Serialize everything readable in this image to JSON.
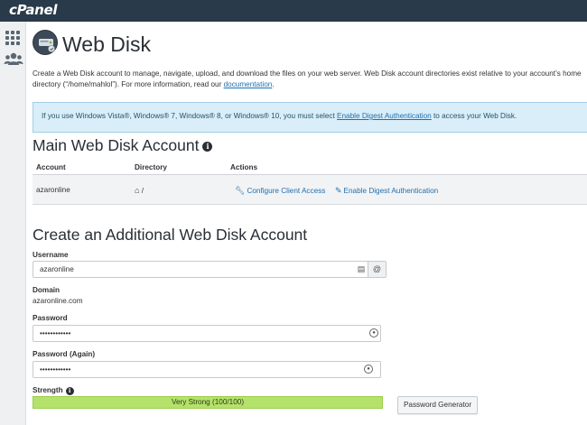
{
  "topbar": {
    "logo": "cPanel"
  },
  "rail": {
    "items": [
      {
        "icon": "grid-icon"
      },
      {
        "icon": "users-icon"
      }
    ]
  },
  "page": {
    "title": "Web Disk",
    "intro_text": "Create a Web Disk account to manage, navigate, upload, and download the files on your web server. Web Disk account directories exist relative to your account’s home directory (“/home/mahlol”). For more information, read our ",
    "intro_link": "documentation",
    "intro_end": "."
  },
  "alert": {
    "text_before": "If you use Windows Vista®, Windows® 7, Windows® 8, or Windows® 10, you must select ",
    "link": "Enable Digest Authentication",
    "text_after": " to access your Web Disk."
  },
  "main_account": {
    "heading": "Main Web Disk Account",
    "columns": {
      "account": "Account",
      "directory": "Directory",
      "actions": "Actions"
    },
    "row": {
      "account": "azaronline",
      "directory": "/",
      "action_configure": "Configure Client Access",
      "action_digest": "Enable Digest Authentication"
    }
  },
  "create_form": {
    "heading": "Create an Additional Web Disk Account",
    "username_label": "Username",
    "username_value": "azaronline",
    "username_suffix": "@",
    "domain_label": "Domain",
    "domain_value": "azaronline.com",
    "password_label": "Password",
    "password_value": "••••••••••••",
    "password_again_label": "Password (Again)",
    "password_again_value": "••••••••••••",
    "strength_label": "Strength",
    "strength_value": "Very Strong (100/100)",
    "strength_percent": 100,
    "generator_label": "Password Generator"
  },
  "colors": {
    "topbar": "#293a4a",
    "link": "#1f6fb0",
    "strength": "#b5e26a",
    "alert_bg": "#d9eef8"
  }
}
